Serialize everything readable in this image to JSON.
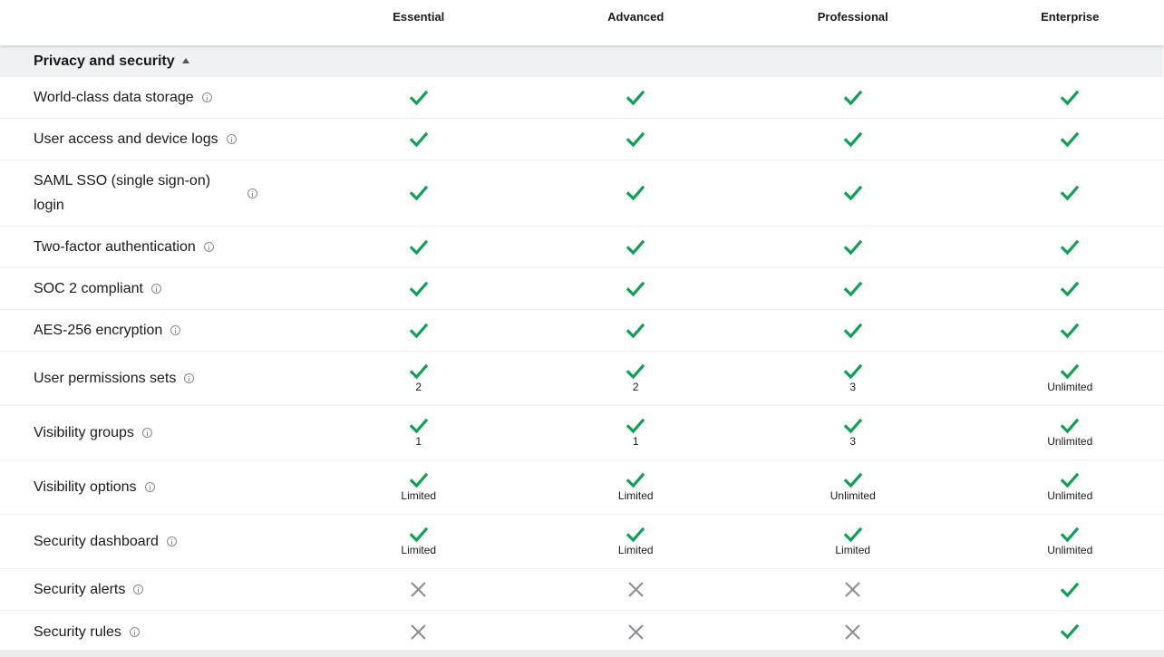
{
  "plans": [
    "Essential",
    "Advanced",
    "Professional",
    "Enterprise"
  ],
  "section": {
    "title": "Privacy and security",
    "expanded": true
  },
  "colors": {
    "check": "#0fa153",
    "cross": "#8c9096",
    "section_bg": "#f0f1f3"
  },
  "rows": [
    {
      "label": "World-class data storage",
      "cells": [
        {
          "mark": "check"
        },
        {
          "mark": "check"
        },
        {
          "mark": "check"
        },
        {
          "mark": "check"
        }
      ]
    },
    {
      "label": "User access and device logs",
      "cells": [
        {
          "mark": "check"
        },
        {
          "mark": "check"
        },
        {
          "mark": "check"
        },
        {
          "mark": "check"
        }
      ]
    },
    {
      "label": "SAML SSO (single sign-on) login",
      "cells": [
        {
          "mark": "check"
        },
        {
          "mark": "check"
        },
        {
          "mark": "check"
        },
        {
          "mark": "check"
        }
      ]
    },
    {
      "label": "Two-factor authentication",
      "cells": [
        {
          "mark": "check"
        },
        {
          "mark": "check"
        },
        {
          "mark": "check"
        },
        {
          "mark": "check"
        }
      ]
    },
    {
      "label": "SOC 2 compliant",
      "cells": [
        {
          "mark": "check"
        },
        {
          "mark": "check"
        },
        {
          "mark": "check"
        },
        {
          "mark": "check"
        }
      ]
    },
    {
      "label": "AES-256 encryption",
      "cells": [
        {
          "mark": "check"
        },
        {
          "mark": "check"
        },
        {
          "mark": "check"
        },
        {
          "mark": "check"
        }
      ]
    },
    {
      "label": "User permissions sets",
      "cells": [
        {
          "mark": "check",
          "note": "2"
        },
        {
          "mark": "check",
          "note": "2"
        },
        {
          "mark": "check",
          "note": "3"
        },
        {
          "mark": "check",
          "note": "Unlimited"
        }
      ]
    },
    {
      "label": "Visibility groups",
      "cells": [
        {
          "mark": "check",
          "note": "1"
        },
        {
          "mark": "check",
          "note": "1"
        },
        {
          "mark": "check",
          "note": "3"
        },
        {
          "mark": "check",
          "note": "Unlimited"
        }
      ]
    },
    {
      "label": "Visibility options",
      "cells": [
        {
          "mark": "check",
          "note": "Limited"
        },
        {
          "mark": "check",
          "note": "Limited"
        },
        {
          "mark": "check",
          "note": "Unlimited"
        },
        {
          "mark": "check",
          "note": "Unlimited"
        }
      ]
    },
    {
      "label": "Security dashboard",
      "cells": [
        {
          "mark": "check",
          "note": "Limited"
        },
        {
          "mark": "check",
          "note": "Limited"
        },
        {
          "mark": "check",
          "note": "Limited"
        },
        {
          "mark": "check",
          "note": "Unlimited"
        }
      ]
    },
    {
      "label": "Security alerts",
      "cells": [
        {
          "mark": "cross"
        },
        {
          "mark": "cross"
        },
        {
          "mark": "cross"
        },
        {
          "mark": "check"
        }
      ]
    },
    {
      "label": "Security rules",
      "cells": [
        {
          "mark": "cross"
        },
        {
          "mark": "cross"
        },
        {
          "mark": "cross"
        },
        {
          "mark": "check"
        }
      ]
    }
  ]
}
